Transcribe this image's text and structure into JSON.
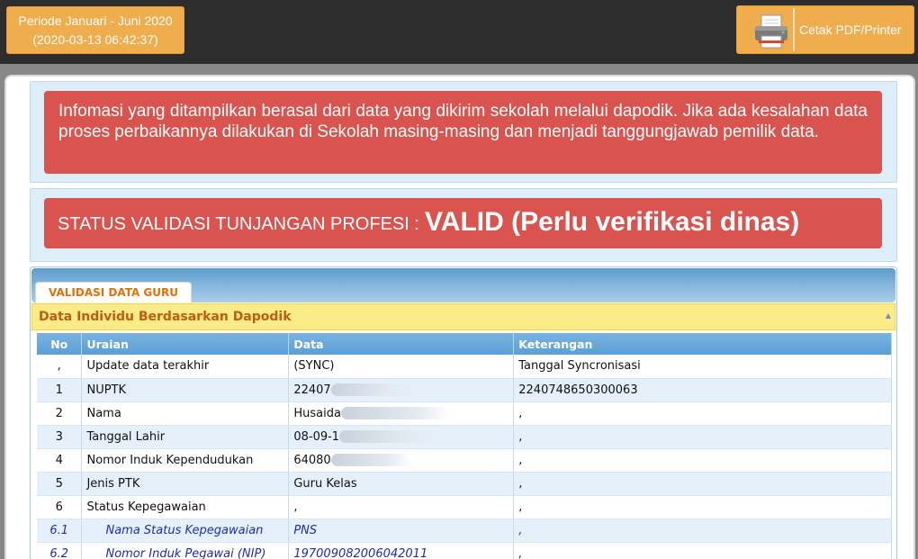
{
  "header": {
    "period_line1": "Periode Januari - Juni 2020",
    "period_line2": "(2020-03-13 06:42:37)",
    "print_label": "Cetak PDF/Printer"
  },
  "alerts": {
    "info": "Infomasi yang ditampilkan berasal dari data yang dikirim sekolah melalui dapodik. Jika ada kesalahan data proses perbaikannya dilakukan di Sekolah masing-masing dan menjadi tanggungjawab pemilik data.",
    "status_label": "STATUS VALIDASI TUNJANGAN PROFESI :",
    "status_value": "VALID (Perlu verifikasi dinas)"
  },
  "tabs": [
    {
      "label": "VALIDASI DATA GURU"
    }
  ],
  "accordion": {
    "title": "Data Individu Berdasarkan Dapodik"
  },
  "table": {
    "headers": [
      "No",
      "Uraian",
      "Data",
      "Keterangan"
    ],
    "rows": [
      {
        "no": ",",
        "uraian": "Update data terakhir",
        "data": "(SYNC)",
        "keterangan": "Tanggal Syncronisasi"
      },
      {
        "no": "1",
        "uraian": "NUPTK",
        "data": "22407",
        "keterangan": "2240748650300063"
      },
      {
        "no": "2",
        "uraian": "Nama",
        "data": "Husaida",
        "keterangan": ","
      },
      {
        "no": "3",
        "uraian": "Tanggal Lahir",
        "data": "08-09-1",
        "keterangan": ","
      },
      {
        "no": "4",
        "uraian": "Nomor Induk Kependudukan",
        "data": "64080",
        "keterangan": ","
      },
      {
        "no": "5",
        "uraian": "Jenis PTK",
        "data": "Guru Kelas",
        "keterangan": ","
      },
      {
        "no": "6",
        "uraian": "Status Kepegawaian",
        "data": ",",
        "keterangan": ","
      },
      {
        "no": "6.1",
        "uraian": "Nama Status Kepegawaian",
        "data": "PNS",
        "keterangan": ","
      },
      {
        "no": "6.2",
        "uraian": "Nomor Induk Pegawai (NIP)",
        "data": "197009082006042011",
        "keterangan": ","
      }
    ]
  },
  "colors": {
    "accent": "#f0ad4e",
    "danger": "#d9534f",
    "header_blue": "#5c9ccc"
  }
}
